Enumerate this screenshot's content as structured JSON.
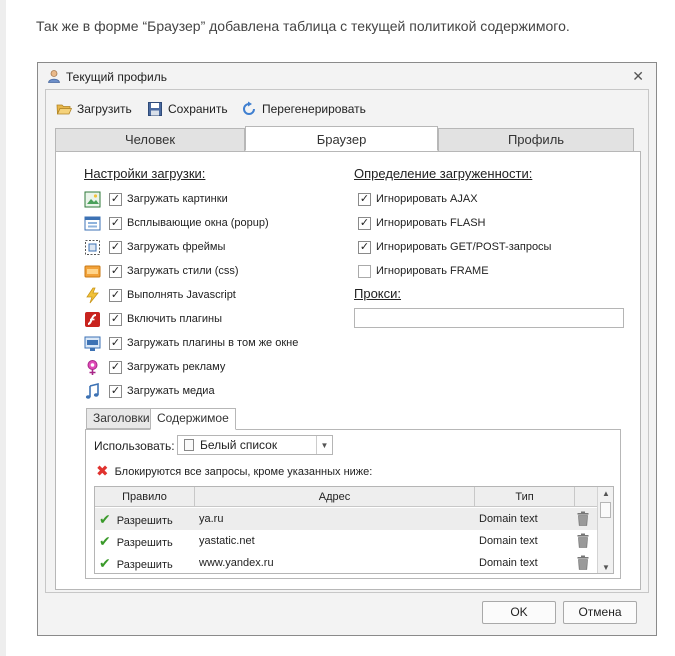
{
  "intro_text": "Так же в форме “Браузер” добавлена таблица с текущей политикой содержимого.",
  "window": {
    "title": "Текущий профиль",
    "close_glyph": "✕"
  },
  "toolbar": {
    "load_label": "Загрузить",
    "save_label": "Сохранить",
    "regenerate_label": "Перегенерировать"
  },
  "tabs": [
    {
      "label": "Человек",
      "active": false
    },
    {
      "label": "Браузер",
      "active": true
    },
    {
      "label": "Профиль",
      "active": false
    }
  ],
  "load_settings": {
    "title": "Настройки загрузки:",
    "items": [
      {
        "label": "Загружать картинки",
        "checked": true,
        "icon": "image-icon"
      },
      {
        "label": "Всплывающие окна (popup)",
        "checked": true,
        "icon": "popup-icon"
      },
      {
        "label": "Загружать фреймы",
        "checked": true,
        "icon": "frame-icon"
      },
      {
        "label": "Загружать стили (css)",
        "checked": true,
        "icon": "css-icon"
      },
      {
        "label": "Выполнять Javascript",
        "checked": true,
        "icon": "lightning-icon"
      },
      {
        "label": "Включить плагины",
        "checked": true,
        "icon": "flash-plugin-icon"
      },
      {
        "label": "Загружать плагины в том же окне",
        "checked": true,
        "icon": "window-plugin-icon"
      },
      {
        "label": "Загружать рекламу",
        "checked": true,
        "icon": "ad-icon"
      },
      {
        "label": "Загружать медиа",
        "checked": true,
        "icon": "music-icon"
      }
    ]
  },
  "load_detect": {
    "title": "Определение загруженности:",
    "items": [
      {
        "label": "Игнорировать AJAX",
        "checked": true
      },
      {
        "label": "Игнорировать FLASH",
        "checked": true
      },
      {
        "label": "Игнорировать GET/POST-запросы",
        "checked": true
      },
      {
        "label": "Игнорировать FRAME",
        "checked": false
      }
    ]
  },
  "proxy": {
    "title": "Прокси:",
    "value": ""
  },
  "subtabs": [
    {
      "label": "Заголовки",
      "active": false
    },
    {
      "label": "Содержимое",
      "active": true
    }
  ],
  "content": {
    "use_label": "Использовать:",
    "list_value": "Белый список",
    "block_message": "Блокируются все запросы, кроме указанных ниже:",
    "columns": [
      "Правило",
      "Адрес",
      "Тип"
    ],
    "rows": [
      {
        "rule": "Разрешить",
        "address": "ya.ru",
        "type": "Domain text"
      },
      {
        "rule": "Разрешить",
        "address": "yastatic.net",
        "type": "Domain text"
      },
      {
        "rule": "Разрешить",
        "address": "www.yandex.ru",
        "type": "Domain text"
      }
    ]
  },
  "buttons": {
    "ok": "OK",
    "cancel": "Отмена"
  },
  "colors": {
    "accent_green": "#3a9a2a",
    "block_red": "#e0332f",
    "window_bg": "#f3f3f3"
  }
}
